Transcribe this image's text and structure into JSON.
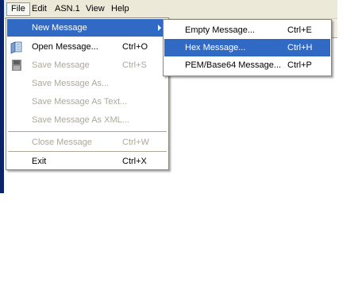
{
  "menubar": {
    "items": [
      "File",
      "Edit",
      "ASN.1",
      "View",
      "Help"
    ]
  },
  "file_menu": {
    "items": [
      {
        "label": "New Message",
        "shortcut": "",
        "has_submenu": true,
        "state": "selected"
      },
      {
        "label": "Open Message...",
        "shortcut": "Ctrl+O",
        "icon": "open-folder-icon",
        "state": "enabled"
      },
      {
        "label": "Save Message",
        "shortcut": "Ctrl+S",
        "icon": "floppy-disk-icon",
        "state": "disabled"
      },
      {
        "label": "Save Message As...",
        "shortcut": "",
        "state": "disabled"
      },
      {
        "label": "Save Message As Text...",
        "shortcut": "",
        "state": "disabled"
      },
      {
        "label": "Save Message As XML...",
        "shortcut": "",
        "state": "disabled"
      },
      {
        "label": "Close Message",
        "shortcut": "Ctrl+W",
        "state": "disabled"
      },
      {
        "label": "Exit",
        "shortcut": "Ctrl+X",
        "state": "enabled"
      }
    ]
  },
  "new_message_submenu": {
    "items": [
      {
        "label": "Empty Message...",
        "shortcut": "Ctrl+E",
        "state": "enabled"
      },
      {
        "label": "Hex Message...",
        "shortcut": "Ctrl+H",
        "state": "selected"
      },
      {
        "label": "PEM/Base64 Message...",
        "shortcut": "Ctrl+P",
        "state": "enabled"
      }
    ]
  },
  "colors": {
    "highlight": "#316ac5",
    "disabled_text": "#aca899",
    "menubar_bg": "#ece9d8"
  }
}
